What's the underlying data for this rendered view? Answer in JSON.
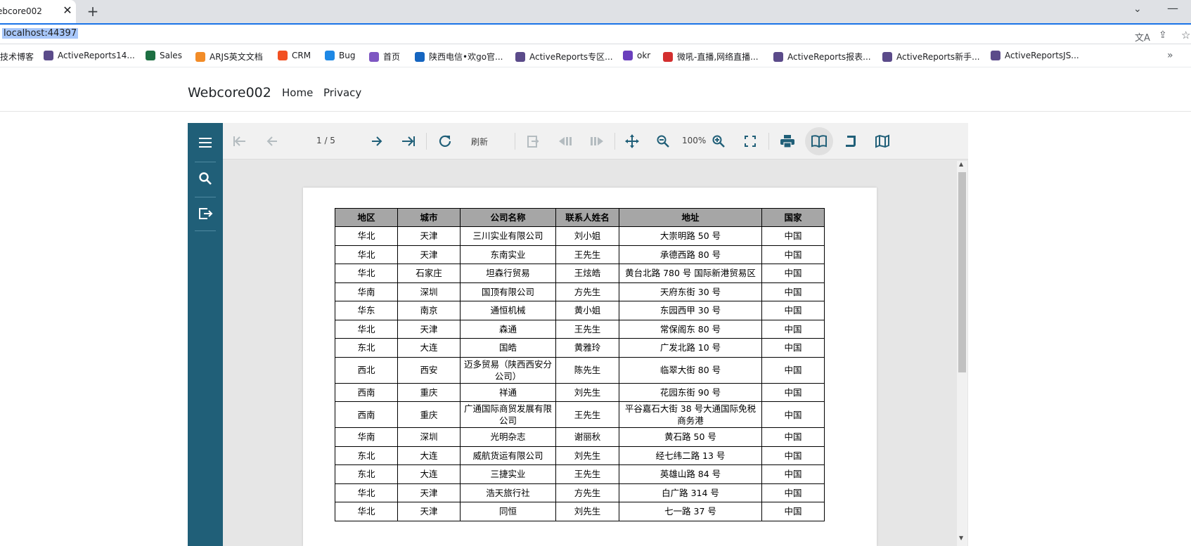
{
  "browser": {
    "tab_title": "ebcore002",
    "tab_close": "✕",
    "new_tab": "+",
    "tabs_menu": "⌄",
    "window_min": "—",
    "url": "localhost:44397",
    "bookmarks": [
      {
        "label": "技术博客",
        "icon": "none"
      },
      {
        "label": "ActiveReports14...",
        "icon": "activereports-icon",
        "color": "#5b4b8a"
      },
      {
        "label": "Sales",
        "icon": "excel-icon",
        "color": "#1d6f42"
      },
      {
        "label": "ARJS英文文档",
        "icon": "arjs-icon",
        "color": "#f28c28"
      },
      {
        "label": "CRM",
        "icon": "windows-icon",
        "color": "#f25022"
      },
      {
        "label": "Bug",
        "icon": "diamond-icon",
        "color": "#1e88e5"
      },
      {
        "label": "首页",
        "icon": "page-icon",
        "color": "#7e57c2"
      },
      {
        "label": "陕西电信•欢go官...",
        "icon": "telecom-icon",
        "color": "#1565c0"
      },
      {
        "label": "ActiveReports专区...",
        "icon": "activereports-icon",
        "color": "#5b4b8a"
      },
      {
        "label": "okr",
        "icon": "okr-icon",
        "color": "#6a3fbd"
      },
      {
        "label": "微吼-直播,网络直播...",
        "icon": "vhall-icon",
        "color": "#d32f2f"
      },
      {
        "label": "ActiveReports报表...",
        "icon": "activereports-icon",
        "color": "#5b4b8a"
      },
      {
        "label": "ActiveReports新手...",
        "icon": "activereports-icon",
        "color": "#5b4b8a"
      },
      {
        "label": "ActiveReportsJS...",
        "icon": "activereports-icon",
        "color": "#5b4b8a"
      }
    ],
    "bookmarks_more": "»"
  },
  "site": {
    "brand": "Webcore002",
    "nav": [
      "Home",
      "Privacy"
    ]
  },
  "viewer": {
    "accent_color": "#205f78",
    "page_indicator": "1 / 5",
    "refresh_label": "刷新",
    "zoom_level": "100%",
    "toolbar_icons": [
      "first-page-icon",
      "prev-page-icon",
      "next-page-icon",
      "last-page-icon",
      "refresh-icon",
      "export-icon",
      "history-back-icon",
      "history-forward-icon",
      "pan-icon",
      "zoom-out-icon",
      "zoom-in-icon",
      "fullscreen-icon",
      "print-icon",
      "single-page-icon",
      "continuous-icon",
      "galley-icon"
    ],
    "sidebar_icons": [
      "menu-icon",
      "search-icon",
      "export-sidebar-icon"
    ]
  },
  "report": {
    "headers": [
      "地区",
      "城市",
      "公司名称",
      "联系人姓名",
      "地址",
      "国家"
    ],
    "rows": [
      [
        "华北",
        "天津",
        "三川实业有限公司",
        "刘小姐",
        "大崇明路 50 号",
        "中国"
      ],
      [
        "华北",
        "天津",
        "东南实业",
        "王先生",
        "承德西路 80 号",
        "中国"
      ],
      [
        "华北",
        "石家庄",
        "坦森行贸易",
        "王炫皓",
        "黄台北路 780 号 国际新港贸易区",
        "中国"
      ],
      [
        "华南",
        "深圳",
        "国顶有限公司",
        "方先生",
        "天府东街 30 号",
        "中国"
      ],
      [
        "华东",
        "南京",
        "通恒机械",
        "黄小姐",
        "东园西甲 30 号",
        "中国"
      ],
      [
        "华北",
        "天津",
        "森通",
        "王先生",
        "常保阁东 80 号",
        "中国"
      ],
      [
        "东北",
        "大连",
        "国皓",
        "黄雅玲",
        "广发北路 10 号",
        "中国"
      ],
      [
        "西北",
        "西安",
        "迈多贸易（陕西西安分公司）",
        "陈先生",
        "临翠大街 80 号",
        "中国"
      ],
      [
        "西南",
        "重庆",
        "祥通",
        "刘先生",
        "花园东街 90 号",
        "中国"
      ],
      [
        "西南",
        "重庆",
        "广通国际商贸发展有限公司",
        "王先生",
        "平谷嘉石大街 38 号大通国际免税商务港",
        "中国"
      ],
      [
        "华南",
        "深圳",
        "光明杂志",
        "谢丽秋",
        "黄石路 50 号",
        "中国"
      ],
      [
        "东北",
        "大连",
        "威航货运有限公司",
        "刘先生",
        "经七纬二路 13 号",
        "中国"
      ],
      [
        "东北",
        "大连",
        "三捷实业",
        "王先生",
        "英雄山路 84 号",
        "中国"
      ],
      [
        "华北",
        "天津",
        "浩天旅行社",
        "方先生",
        "白广路 314 号",
        "中国"
      ],
      [
        "华北",
        "天津",
        "同恒",
        "刘先生",
        "七一路 37 号",
        "中国"
      ]
    ]
  }
}
